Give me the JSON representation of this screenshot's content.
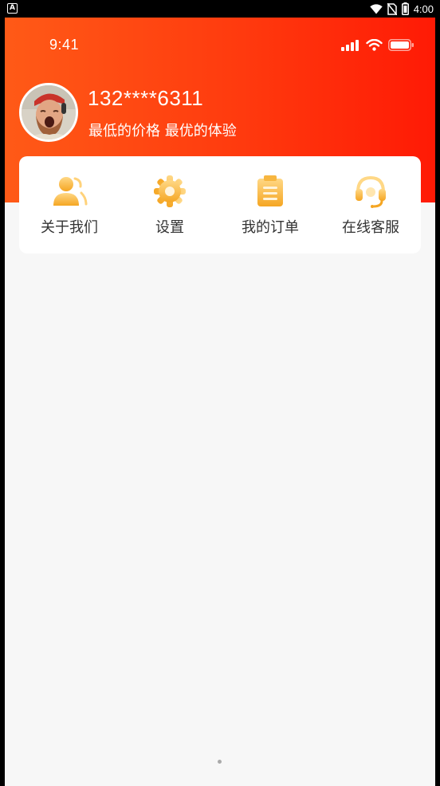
{
  "android_status_bar": {
    "time": "4:00",
    "icons": [
      "notification-a-icon",
      "wifi-icon",
      "no-sim-icon",
      "battery-icon"
    ]
  },
  "ios_status_bar": {
    "time": "9:41",
    "icons": [
      "cellular-signal-icon",
      "wifi-icon",
      "battery-icon"
    ]
  },
  "profile": {
    "phone": "132****6311",
    "slogan": "最低的价格 最优的体验"
  },
  "menu": [
    {
      "label": "关于我们",
      "icon": "about-us-icon"
    },
    {
      "label": "设置",
      "icon": "gear-icon"
    },
    {
      "label": "我的订单",
      "icon": "order-clipboard-icon"
    },
    {
      "label": "在线客服",
      "icon": "headset-icon"
    }
  ],
  "colors": {
    "header_start": "#ff5a17",
    "header_end": "#ff1a05",
    "icon_gold_light": "#ffd27a",
    "icon_gold_dark": "#f5a623",
    "background": "#f7f7f7"
  }
}
